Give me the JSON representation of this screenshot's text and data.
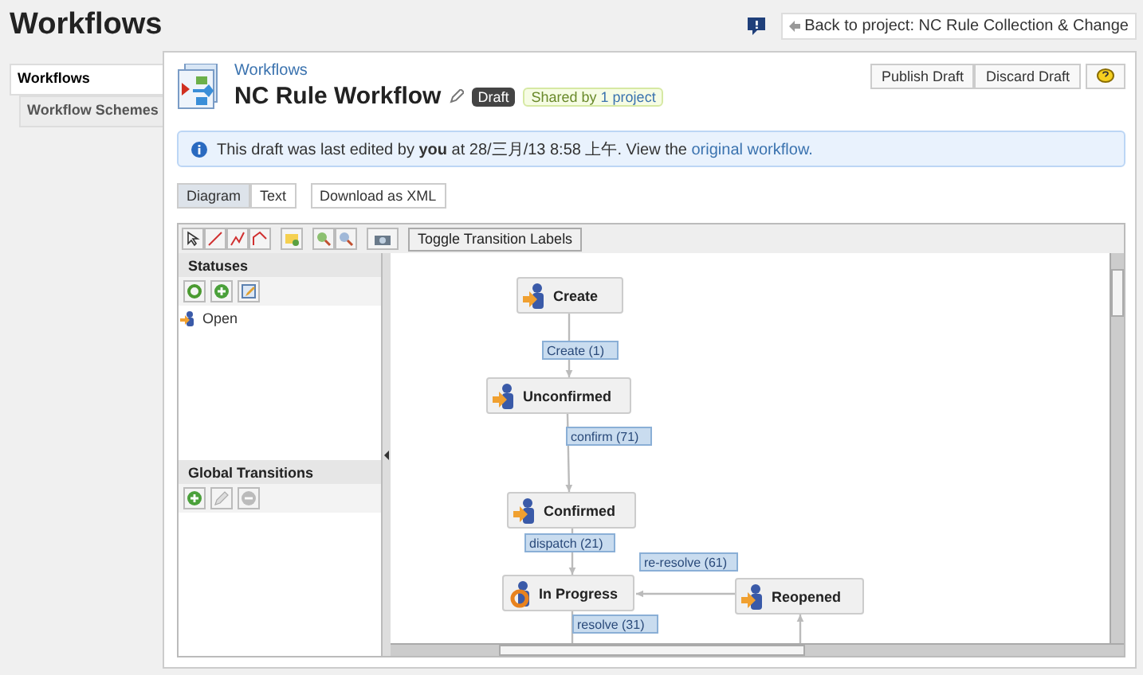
{
  "page": {
    "title": "Workflows",
    "back_link": "Back to project: NC Rule Collection & Change"
  },
  "nav_tabs": [
    {
      "label": "Workflows",
      "selected": true
    },
    {
      "label": "Workflow Schemes",
      "selected": false
    }
  ],
  "workflow": {
    "breadcrumb": "Workflows",
    "title": "NC Rule Workflow",
    "status_badge": "Draft",
    "shared_prefix": "Shared by",
    "shared_link": "1 project",
    "actions": [
      "Publish Draft",
      "Discard Draft"
    ]
  },
  "info": {
    "message": "This draft was last edited by **you** at 28/三月/13 8:58 上午. View the",
    "link": "original workflow."
  },
  "view_tabs": [
    {
      "label": "Diagram",
      "selected": true
    },
    {
      "label": "Text",
      "selected": false
    }
  ],
  "download_button": "Download as XML",
  "toolbar": {
    "toggle_button": "Toggle Transition Labels"
  },
  "statuses": {
    "heading": "Statuses",
    "items": [
      {
        "name": "Open"
      }
    ]
  },
  "global_transitions": {
    "heading": "Global Transitions"
  },
  "diagram": {
    "nodes": [
      {
        "name": "Create",
        "kind": "person"
      },
      {
        "name": "Unconfirmed",
        "kind": "person"
      },
      {
        "name": "Confirmed",
        "kind": "person"
      },
      {
        "name": "In Progress",
        "kind": "progress"
      },
      {
        "name": "Reopened",
        "kind": "person"
      }
    ],
    "transitions": [
      {
        "label": "Create (1)"
      },
      {
        "label": "confirm (71)"
      },
      {
        "label": "dispatch (21)"
      },
      {
        "label": "re-resolve (61)"
      },
      {
        "label": "resolve (31)"
      }
    ]
  }
}
